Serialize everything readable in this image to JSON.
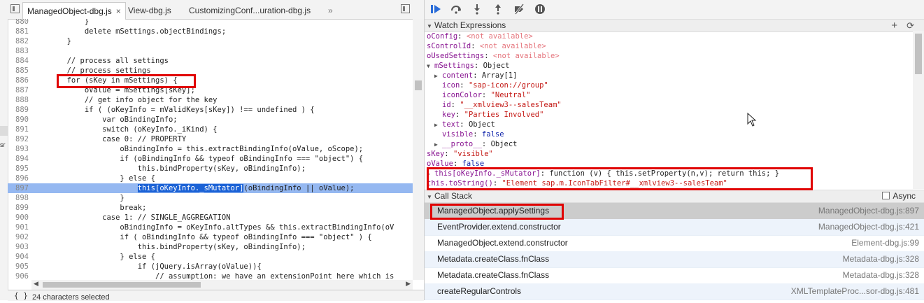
{
  "left_edge": {
    "fragment": "sr"
  },
  "editor": {
    "tabs": [
      {
        "label": "ManagedObject-dbg.js",
        "close": "×"
      },
      {
        "label": "View-dbg.js"
      },
      {
        "label": "CustomizingConf...uration-dbg.js"
      }
    ],
    "more_tabs": "»",
    "lines": [
      {
        "n": "880",
        "t": "            }"
      },
      {
        "n": "881",
        "t": "            delete mSettings.objectBindings;"
      },
      {
        "n": "882",
        "t": "        }"
      },
      {
        "n": "883",
        "t": ""
      },
      {
        "n": "884",
        "t": "        // process all settings"
      },
      {
        "n": "885",
        "t": "        // process settings"
      },
      {
        "n": "886",
        "t": "        for (sKey in mSettings) {"
      },
      {
        "n": "887",
        "t": "            oValue = mSettings[sKey];"
      },
      {
        "n": "888",
        "t": "            // get info object for the key"
      },
      {
        "n": "889",
        "t": "            if ( (oKeyInfo = mValidKeys[sKey]) !== undefined ) {"
      },
      {
        "n": "890",
        "t": "                var oBindingInfo;"
      },
      {
        "n": "891",
        "t": "                switch (oKeyInfo._iKind) {"
      },
      {
        "n": "892",
        "t": "                case 0: // PROPERTY"
      },
      {
        "n": "893",
        "t": "                    oBindingInfo = this.extractBindingInfo(oValue, oScope);"
      },
      {
        "n": "894",
        "t": "                    if (oBindingInfo && typeof oBindingInfo === \"object\") {"
      },
      {
        "n": "895",
        "t": "                        this.bindProperty(sKey, oBindingInfo);"
      },
      {
        "n": "896",
        "t": "                    } else {"
      },
      {
        "n": "897",
        "t": "                        this[oKeyInfo._sMutator](oBindingInfo || oValue);"
      },
      {
        "n": "898",
        "t": "                    }"
      },
      {
        "n": "899",
        "t": "                    break;"
      },
      {
        "n": "900",
        "t": "                case 1: // SINGLE_AGGREGATION"
      },
      {
        "n": "901",
        "t": "                    oBindingInfo = oKeyInfo.altTypes && this.extractBindingInfo(oV"
      },
      {
        "n": "902",
        "t": "                    if ( oBindingInfo && typeof oBindingInfo === \"object\" ) {"
      },
      {
        "n": "903",
        "t": "                        this.bindProperty(sKey, oBindingInfo);"
      },
      {
        "n": "904",
        "t": "                    } else {"
      },
      {
        "n": "905",
        "t": "                        if (jQuery.isArray(oValue)){"
      },
      {
        "n": "906",
        "t": "                            // assumption: we have an extensionPoint here which is"
      },
      {
        "n": "907",
        "t": ""
      }
    ],
    "selection_text": "this[oKeyInfo._sMutator]",
    "status": {
      "braces": "{ }",
      "text": "24 characters selected"
    }
  },
  "debugger": {
    "watch": {
      "title": "Watch Expressions",
      "add": "+",
      "refresh": "⟳",
      "rows": [
        {
          "indent": 0,
          "tri": "",
          "key": "oConfig",
          "sep": ": ",
          "val": "<not available>",
          "vt": "na"
        },
        {
          "indent": 0,
          "tri": "",
          "key": "sControlId",
          "sep": ": ",
          "val": "<not available>",
          "vt": "na"
        },
        {
          "indent": 0,
          "tri": "",
          "key": "oUsedSettings",
          "sep": ": ",
          "val": "<not available>",
          "vt": "na"
        },
        {
          "indent": 0,
          "tri": "▼",
          "key": "mSettings",
          "sep": ": ",
          "val": "Object",
          "vt": "val"
        },
        {
          "indent": 1,
          "tri": "▶",
          "key": "content",
          "sep": ": ",
          "val": "Array[1]",
          "vt": "val"
        },
        {
          "indent": 1,
          "tri": "",
          "key": "icon",
          "sep": ": ",
          "val": "\"sap-icon://group\"",
          "vt": "str"
        },
        {
          "indent": 1,
          "tri": "",
          "key": "iconColor",
          "sep": ": ",
          "val": "\"Neutral\"",
          "vt": "str"
        },
        {
          "indent": 1,
          "tri": "",
          "key": "id",
          "sep": ": ",
          "val": "\"__xmlview3--salesTeam\"",
          "vt": "str"
        },
        {
          "indent": 1,
          "tri": "",
          "key": "key",
          "sep": ": ",
          "val": "\"Parties Involved\"",
          "vt": "str"
        },
        {
          "indent": 1,
          "tri": "▶",
          "key": "text",
          "sep": ": ",
          "val": "Object",
          "vt": "val"
        },
        {
          "indent": 1,
          "tri": "",
          "key": "visible",
          "sep": ": ",
          "val": "false",
          "vt": "kw"
        },
        {
          "indent": 1,
          "tri": "▶",
          "key": "__proto__",
          "sep": ": ",
          "val": "Object",
          "vt": "val"
        },
        {
          "indent": 0,
          "tri": "",
          "key": "sKey",
          "sep": ": ",
          "val": "\"visible\"",
          "vt": "str"
        },
        {
          "indent": 0,
          "tri": "",
          "key": "oValue",
          "sep": ": ",
          "val": "false",
          "vt": "kw"
        },
        {
          "indent": 0,
          "tri": "▶",
          "key": "this[oKeyInfo._sMutator]",
          "sep": ": ",
          "val": "function (v) { this.setProperty(n,v); return this; }",
          "vt": "val"
        },
        {
          "indent": 0,
          "tri": "",
          "key": "this.toString()",
          "sep": ": ",
          "val": "\"Element sap.m.IconTabFilter#__xmlview3--salesTeam\"",
          "vt": "str"
        }
      ]
    },
    "callstack": {
      "title": "Call Stack",
      "async_label": "Async",
      "frames": [
        {
          "fn": "ManagedObject.applySettings",
          "loc": "ManagedObject-dbg.js:897"
        },
        {
          "fn": "EventProvider.extend.constructor",
          "loc": "ManagedObject-dbg.js:421"
        },
        {
          "fn": "ManagedObject.extend.constructor",
          "loc": "Element-dbg.js:99"
        },
        {
          "fn": "Metadata.createClass.fnClass",
          "loc": "Metadata-dbg.js:328"
        },
        {
          "fn": "Metadata.createClass.fnClass",
          "loc": "Metadata-dbg.js:328"
        },
        {
          "fn": "createRegularControls",
          "loc": "XMLTemplateProc...sor-dbg.js:481"
        }
      ]
    }
  },
  "colors": {
    "highlight_box": "#e00000",
    "paused_line": "#95b8f1",
    "selection": "#1b62d6"
  }
}
